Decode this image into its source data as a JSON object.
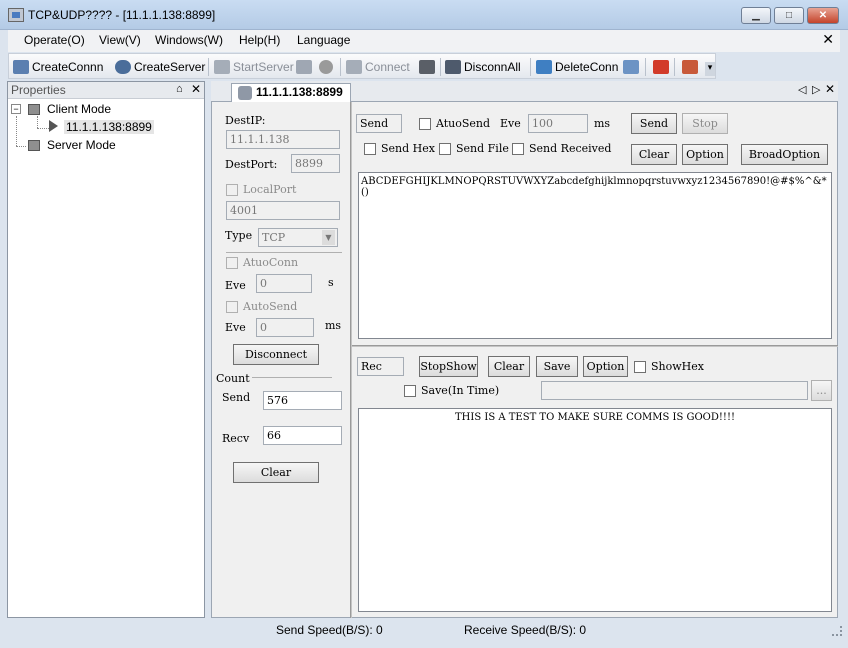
{
  "window": {
    "title": "TCP&UDP???? - [11.1.1.138:8899]",
    "minimize": "▁",
    "maximize": "□",
    "close": "✕"
  },
  "menu": {
    "items": [
      "Operate(O)",
      "View(V)",
      "Windows(W)",
      "Help(H)",
      "Language"
    ],
    "close": "✕"
  },
  "toolbar": {
    "create_conn": "CreateConnn",
    "create_server": "CreateServer",
    "start_server": "StartServer",
    "connect": "Connect",
    "disconn_all": "DisconnAll",
    "delete_conn": "DeleteConn",
    "overflow": "▾"
  },
  "properties": {
    "title": "Properties",
    "pin": "⌂",
    "close": "✕",
    "tree": {
      "client_mode": "Client Mode",
      "client_conn": "11.1.1.138:8899",
      "server_mode": "Server Mode",
      "expander": "−"
    }
  },
  "conn_tab": {
    "label": "11.1.1.138:8899",
    "nav_left": "◁",
    "nav_right": "▷",
    "close": "✕"
  },
  "left": {
    "dest_ip_label": "DestIP:",
    "dest_ip": "11.1.1.138",
    "dest_port_label": "DestPort:",
    "dest_port": "8899",
    "local_port_label": "LocalPort",
    "local_port": "4001",
    "type_label": "Type",
    "type_value": "TCP",
    "auto_conn_label": "AtuoConn",
    "eve_label_1": "Eve",
    "auto_conn_eve": "0",
    "unit_s": "s",
    "auto_send_label": "AutoSend",
    "eve_label_2": "Eve",
    "auto_send_eve": "0",
    "unit_ms": "ms",
    "disconnect": "Disconnect",
    "count_label": "Count",
    "send_label": "Send",
    "send_count": "576",
    "recv_label": "Recv",
    "recv_count": "66",
    "clear": "Clear"
  },
  "send": {
    "header": "Send",
    "auto_send_label": "AtuoSend",
    "eve_label": "Eve",
    "eve_value": "100",
    "unit": "ms",
    "send_btn": "Send",
    "stop_btn": "Stop",
    "send_hex": "Send Hex",
    "send_file": "Send File",
    "send_received": "Send Received",
    "clear_btn": "Clear",
    "option_btn": "Option",
    "broad_option_btn": "BroadOption",
    "content": "ABCDEFGHIJKLMNOPQRSTUVWXYZabcdefghijklmnopqrstuvwxyz1234567890!@#$%^&*()"
  },
  "receive": {
    "header": "Rec",
    "stop_show": "StopShow",
    "clear": "Clear",
    "save": "Save",
    "option": "Option",
    "show_hex": "ShowHex",
    "save_in_time": "Save(In Time)",
    "browse": "...",
    "content": "THIS IS A TEST TO MAKE SURE COMMS IS GOOD!!!!"
  },
  "status": {
    "send_speed": "Send Speed(B/S): 0",
    "receive_speed": "Receive Speed(B/S): 0"
  },
  "colors": {
    "title_bar": "#c9dcf2",
    "close_button": "#c4432b",
    "pane_bg": "#f0f0f0"
  }
}
